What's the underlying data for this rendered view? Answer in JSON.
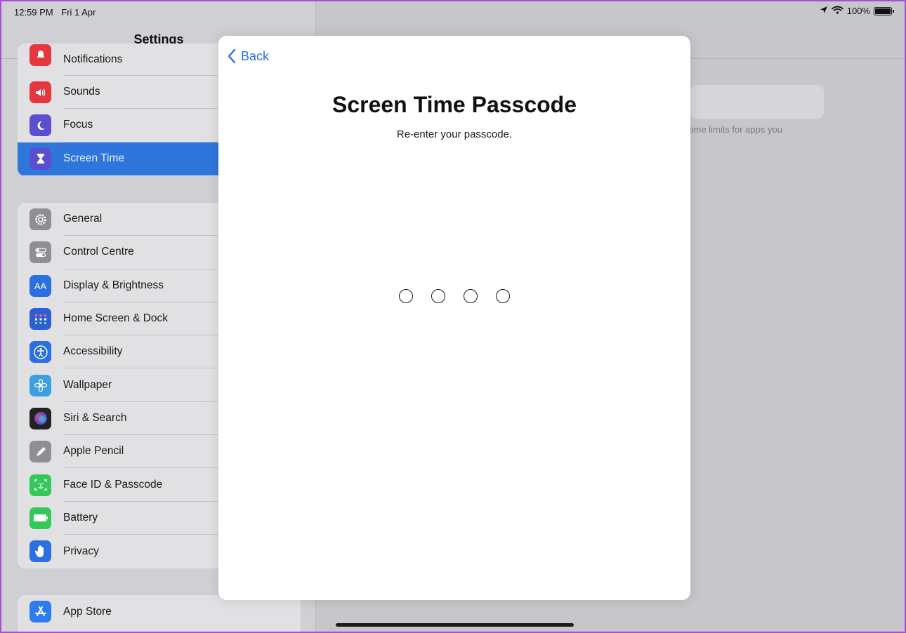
{
  "status_bar": {
    "time": "12:59 PM",
    "date": "Fri 1 Apr",
    "battery": "100%"
  },
  "sidebar": {
    "title": "Settings",
    "groups": [
      {
        "items": [
          {
            "label": "Notifications",
            "icon": "bell-icon",
            "color": "#e5373f"
          },
          {
            "label": "Sounds",
            "icon": "speaker-icon",
            "color": "#e5373f"
          },
          {
            "label": "Focus",
            "icon": "moon-icon",
            "color": "#5b4fd0"
          },
          {
            "label": "Screen Time",
            "icon": "hourglass-icon",
            "color": "#5b4fd0",
            "selected": true
          }
        ]
      },
      {
        "items": [
          {
            "label": "General",
            "icon": "gear-icon",
            "color": "#8e8e93"
          },
          {
            "label": "Control Centre",
            "icon": "toggles-icon",
            "color": "#8e8e93"
          },
          {
            "label": "Display & Brightness",
            "icon": "text-size-icon",
            "color": "#2c6fe0"
          },
          {
            "label": "Home Screen & Dock",
            "icon": "grid-icon",
            "color": "#2c5fd6"
          },
          {
            "label": "Accessibility",
            "icon": "accessibility-icon",
            "color": "#2c6fe0"
          },
          {
            "label": "Wallpaper",
            "icon": "flower-icon",
            "color": "#3aa0e0"
          },
          {
            "label": "Siri & Search",
            "icon": "siri-icon",
            "color": "#222222"
          },
          {
            "label": "Apple Pencil",
            "icon": "pencil-icon",
            "color": "#8e8e93"
          },
          {
            "label": "Face ID & Passcode",
            "icon": "face-id-icon",
            "color": "#34c759"
          },
          {
            "label": "Battery",
            "icon": "battery-icon",
            "color": "#34c759"
          },
          {
            "label": "Privacy",
            "icon": "hand-icon",
            "color": "#2c6fe0"
          }
        ]
      },
      {
        "items": [
          {
            "label": "App Store",
            "icon": "app-store-icon",
            "color": "#2c7cf0"
          }
        ]
      }
    ]
  },
  "detail": {
    "caption": "time limits for apps you"
  },
  "modal": {
    "back_label": "Back",
    "title": "Screen Time Passcode",
    "subtitle": "Re-enter your passcode.",
    "passcode_length": 4,
    "accent_color": "#2a6fdc"
  }
}
